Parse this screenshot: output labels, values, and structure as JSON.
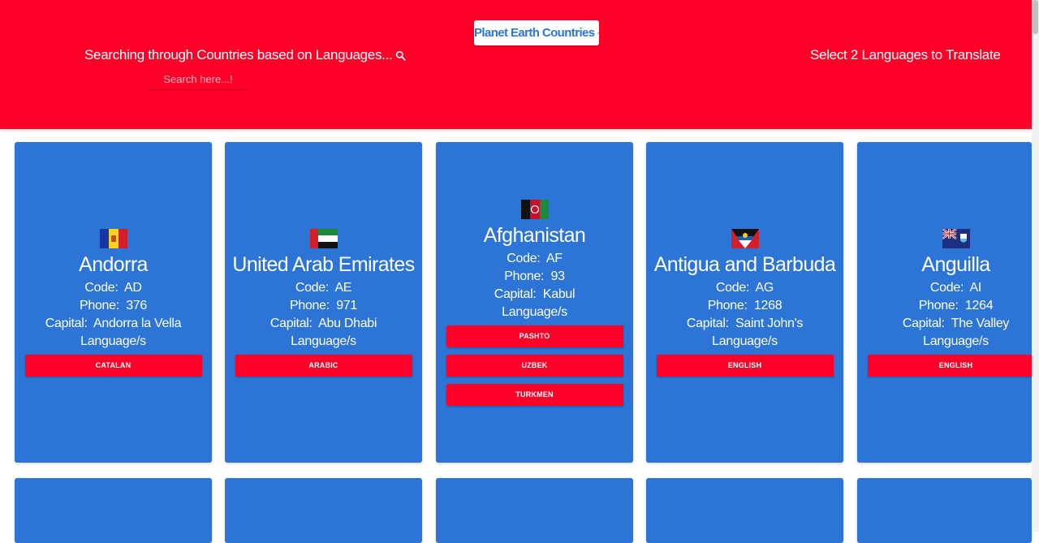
{
  "header": {
    "search_title": "Searching through Countries based on Languages...",
    "search_placeholder": "Search here...!",
    "search_value": "",
    "logo_text": "Planet Earth Countries",
    "translate_label": "Select 2 Languages to Translate",
    "background_color": "#ff0028"
  },
  "labels": {
    "code": "Code:",
    "phone": "Phone:",
    "capital": "Capital:",
    "languages": "Language/s"
  },
  "countries": [
    {
      "name": "Andorra",
      "code": "AD",
      "phone": "376",
      "capital": "Andorra la Vella",
      "flag_icon": "andorra-flag",
      "languages": [
        "CATALAN"
      ]
    },
    {
      "name": "United Arab Emirates",
      "code": "AE",
      "phone": "971",
      "capital": "Abu Dhabi",
      "flag_icon": "uae-flag",
      "languages": [
        "ARABIC"
      ]
    },
    {
      "name": "Afghanistan",
      "code": "AF",
      "phone": "93",
      "capital": "Kabul",
      "flag_icon": "afghanistan-flag",
      "languages": [
        "PASHTO",
        "UZBEK",
        "TURKMEN"
      ]
    },
    {
      "name": "Antigua and Barbuda",
      "code": "AG",
      "phone": "1268",
      "capital": "Saint John's",
      "flag_icon": "antigua-flag",
      "languages": [
        "ENGLISH"
      ]
    },
    {
      "name": "Anguilla",
      "code": "AI",
      "phone": "1264",
      "capital": "The Valley",
      "flag_icon": "anguilla-flag",
      "languages": [
        "ENGLISH"
      ]
    }
  ],
  "colors": {
    "card": "#2c74d6",
    "accent": "#ff0028"
  }
}
